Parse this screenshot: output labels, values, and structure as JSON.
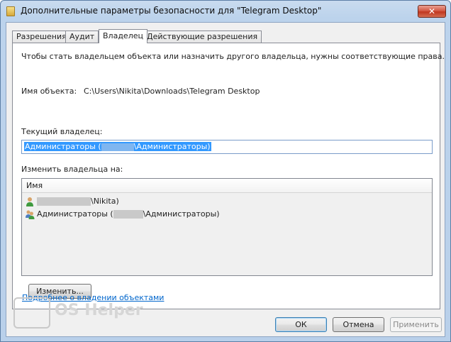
{
  "window": {
    "title": "Дополнительные параметры безопасности для \"Telegram Desktop\"",
    "close_label": "✕"
  },
  "tabs": [
    {
      "label": "Разрешения"
    },
    {
      "label": "Аудит"
    },
    {
      "label": "Владелец"
    },
    {
      "label": "Действующие разрешения"
    }
  ],
  "owner_tab": {
    "intro": "Чтобы стать владельцем объекта или назначить другого владельца, нужны соответствующие права.",
    "object_name_label": "Имя объекта:",
    "object_name_value": "C:\\Users\\Nikita\\Downloads\\Telegram Desktop",
    "current_owner_label": "Текущий владелец:",
    "current_owner_prefix": "Администраторы (",
    "current_owner_suffix": "\\Администраторы)",
    "change_owner_label": "Изменить владельца на:",
    "list_header": "Имя",
    "list_items": [
      {
        "prefix": "",
        "suffix": "\\Nikita)",
        "icon": "user-icon"
      },
      {
        "prefix": "Администраторы (",
        "suffix": "\\Администраторы)",
        "icon": "group-icon"
      }
    ],
    "change_button": "Изменить...",
    "learn_more_link": "Подробнее о владении объектами"
  },
  "footer": {
    "ok": "ОК",
    "cancel": "Отмена",
    "apply": "Применить"
  },
  "watermark": {
    "text": "OS Helper"
  }
}
